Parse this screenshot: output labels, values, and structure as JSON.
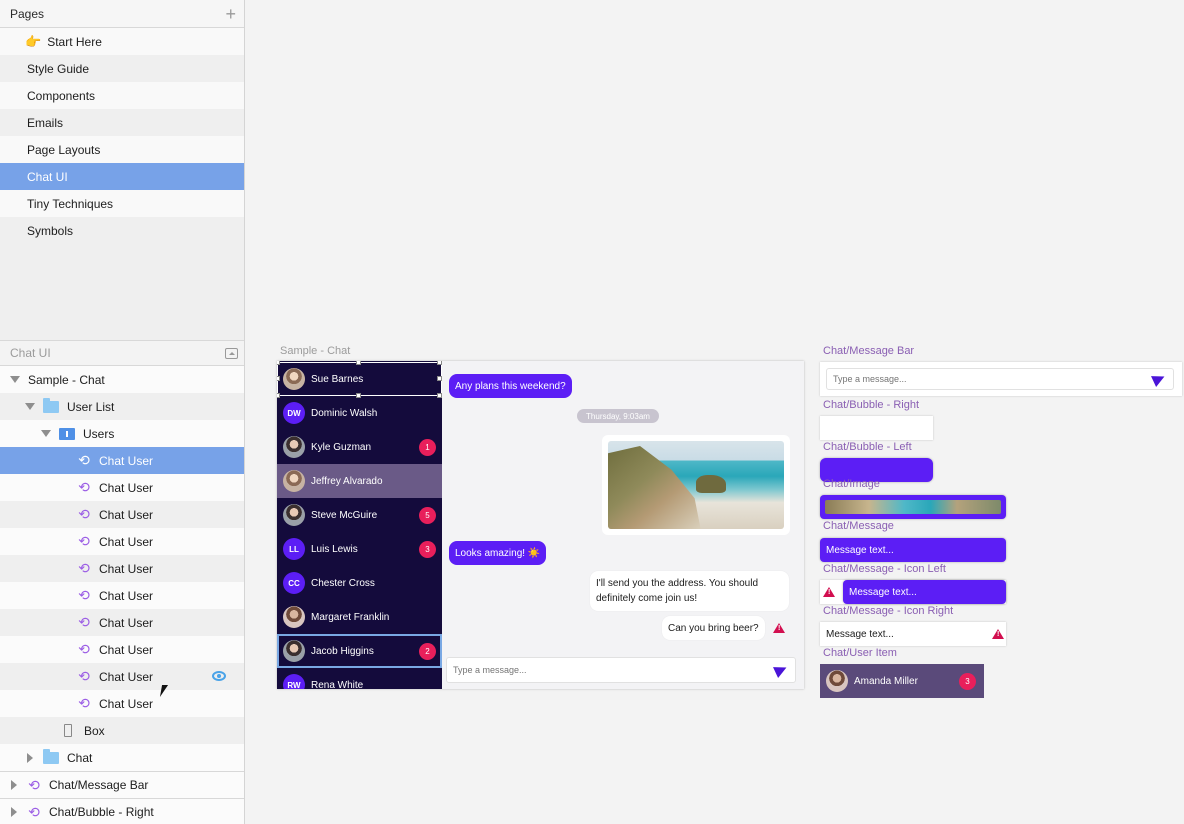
{
  "pages_panel": {
    "title": "Pages",
    "add_icon": "plus-icon",
    "items": [
      {
        "label": "Start Here",
        "icon": "pointing-hand-icon"
      },
      {
        "label": "Style Guide"
      },
      {
        "label": "Components"
      },
      {
        "label": "Emails"
      },
      {
        "label": "Page Layouts"
      },
      {
        "label": "Chat UI",
        "selected": true
      },
      {
        "label": "Tiny Techniques"
      },
      {
        "label": "Symbols"
      }
    ]
  },
  "layers_panel": {
    "title": "Chat UI",
    "items": [
      {
        "label": "Sample - Chat",
        "type": "artboard",
        "expanded": true
      },
      {
        "label": "User List",
        "type": "folder",
        "expanded": true
      },
      {
        "label": "Users",
        "type": "group",
        "expanded": true
      },
      {
        "label": "Chat User",
        "type": "symbol",
        "selected": true
      },
      {
        "label": "Chat User",
        "type": "symbol"
      },
      {
        "label": "Chat User",
        "type": "symbol"
      },
      {
        "label": "Chat User",
        "type": "symbol"
      },
      {
        "label": "Chat User",
        "type": "symbol"
      },
      {
        "label": "Chat User",
        "type": "symbol"
      },
      {
        "label": "Chat User",
        "type": "symbol"
      },
      {
        "label": "Chat User",
        "type": "symbol"
      },
      {
        "label": "Chat User",
        "type": "symbol",
        "visibility_icon": "eye-icon"
      },
      {
        "label": "Chat User",
        "type": "symbol"
      },
      {
        "label": "Box",
        "type": "rectangle"
      },
      {
        "label": "Chat",
        "type": "folder",
        "expanded": false
      },
      {
        "label": "Chat/Message Bar",
        "type": "symbol-master",
        "expanded": false
      },
      {
        "label": "Chat/Bubble - Right",
        "type": "symbol-master",
        "expanded": false
      }
    ]
  },
  "canvas": {
    "artboard_label": "Sample - Chat",
    "users": [
      {
        "name": "Sue Barnes",
        "avatar": "photo"
      },
      {
        "name": "Dominic Walsh",
        "initials": "DW"
      },
      {
        "name": "Kyle Guzman",
        "avatar": "photo",
        "badge": "1"
      },
      {
        "name": "Jeffrey Alvarado",
        "avatar": "photo",
        "highlighted": true
      },
      {
        "name": "Steve McGuire",
        "avatar": "photo",
        "badge": "5"
      },
      {
        "name": "Luis Lewis",
        "initials": "LL",
        "badge": "3"
      },
      {
        "name": "Chester Cross",
        "initials": "CC"
      },
      {
        "name": "Margaret Franklin",
        "avatar": "photo"
      },
      {
        "name": "Jacob Higgins",
        "avatar": "photo",
        "badge": "2"
      },
      {
        "name": "Rena White",
        "initials": "RW"
      }
    ],
    "messages": {
      "m1": "Any plans this weekend?",
      "date": "Thursday, 9:03am",
      "m2": "Looks amazing! ☀️",
      "m3a": "I'll send you the address. You should",
      "m3b": "definitely come join us!",
      "m4": "Can you bring beer?"
    },
    "input_placeholder": "Type a message...",
    "symbols": {
      "message_bar": "Chat/Message Bar",
      "bubble_right": "Chat/Bubble - Right",
      "bubble_left": "Chat/Bubble - Left",
      "image": "Chat/Image",
      "message": "Chat/Message",
      "message_icon_left": "Chat/Message - Icon Left",
      "message_icon_right": "Chat/Message - Icon Right",
      "user_item": "Chat/User Item",
      "message_text": "Message text...",
      "user_item_name": "Amanda Miller",
      "user_item_badge": "3"
    },
    "colors": {
      "accent": "#5c1ef5",
      "sidebar_dark": "#140b3c",
      "alert": "#d20e4f",
      "selection": "#77a2e8"
    }
  }
}
